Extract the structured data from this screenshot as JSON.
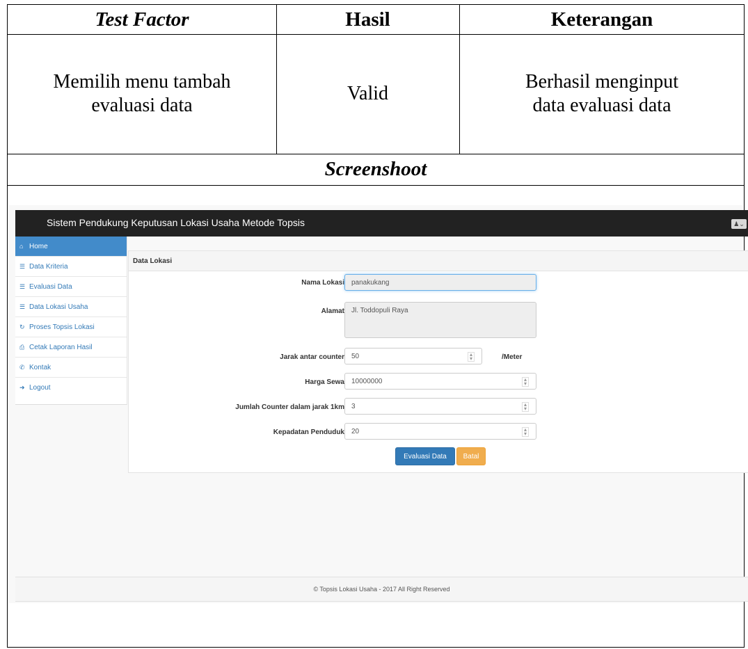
{
  "table": {
    "headers": {
      "test_factor": "Test Factor",
      "hasil": "Hasil",
      "keterangan": "Keterangan"
    },
    "row": {
      "test_factor_line1": "Memilih menu tambah",
      "test_factor_line2": "evaluasi data",
      "hasil": "Valid",
      "keterangan_line1": "Berhasil menginput",
      "keterangan_line2": "data evaluasi data"
    },
    "screenshot_heading": "Screenshoot"
  },
  "app": {
    "title": "Sistem Pendukung Keputusan Lokasi Usaha Metode Topsis",
    "sidebar": {
      "items": [
        {
          "label": "Home",
          "icon": "home-icon",
          "active": true
        },
        {
          "label": "Data Kriteria",
          "icon": "list-icon"
        },
        {
          "label": "Evaluasi Data",
          "icon": "list-icon"
        },
        {
          "label": "Data Lokasi Usaha",
          "icon": "list-icon"
        },
        {
          "label": "Proses Topsis Lokasi",
          "icon": "refresh-icon"
        },
        {
          "label": "Cetak Laporan Hasil",
          "icon": "print-icon"
        },
        {
          "label": "Kontak",
          "icon": "phone-icon"
        },
        {
          "label": "Logout",
          "icon": "logout-icon"
        }
      ]
    },
    "panel": {
      "title": "Data Lokasi",
      "fields": {
        "nama_lokasi": {
          "label": "Nama Lokasi",
          "value": "panakukang"
        },
        "alamat": {
          "label": "Alamat",
          "value": "Jl. Toddopuli Raya"
        },
        "jarak": {
          "label": "Jarak antar counter",
          "value": "50",
          "unit": "/Meter"
        },
        "harga": {
          "label": "Harga Sewa",
          "value": "10000000"
        },
        "jumlah": {
          "label": "Jumlah Counter dalam jarak 1km",
          "value": "3"
        },
        "kepadatan": {
          "label": "Kepadatan Penduduk",
          "value": "20"
        }
      },
      "buttons": {
        "submit": "Evaluasi Data",
        "cancel": "Batal"
      }
    },
    "footer": "© Topsis Lokasi Usaha - 2017 All Right Reserved"
  }
}
